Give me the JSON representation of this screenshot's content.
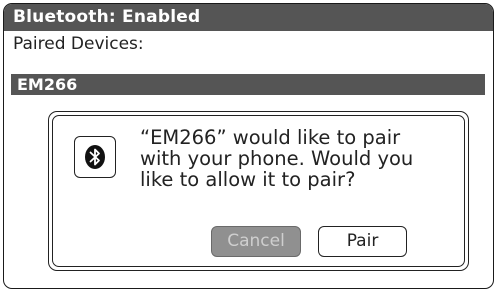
{
  "title_bar": {
    "text": "Bluetooth: Enabled"
  },
  "paired_devices": {
    "label": "Paired Devices:",
    "items": [
      {
        "name": "EM266",
        "selected": true
      }
    ]
  },
  "pair_dialog": {
    "icon": "bluetooth-icon",
    "message": "“EM266” would like to pair\nwith your phone. Would you\nlike to allow it to pair?",
    "cancel_label": "Cancel",
    "pair_label": "Pair",
    "cancel_enabled": false
  },
  "colors": {
    "bar": "#555555",
    "bar_text": "#ffffff",
    "disabled_button": "#909090",
    "disabled_text": "#cfcfcf",
    "outline": "#222222"
  }
}
